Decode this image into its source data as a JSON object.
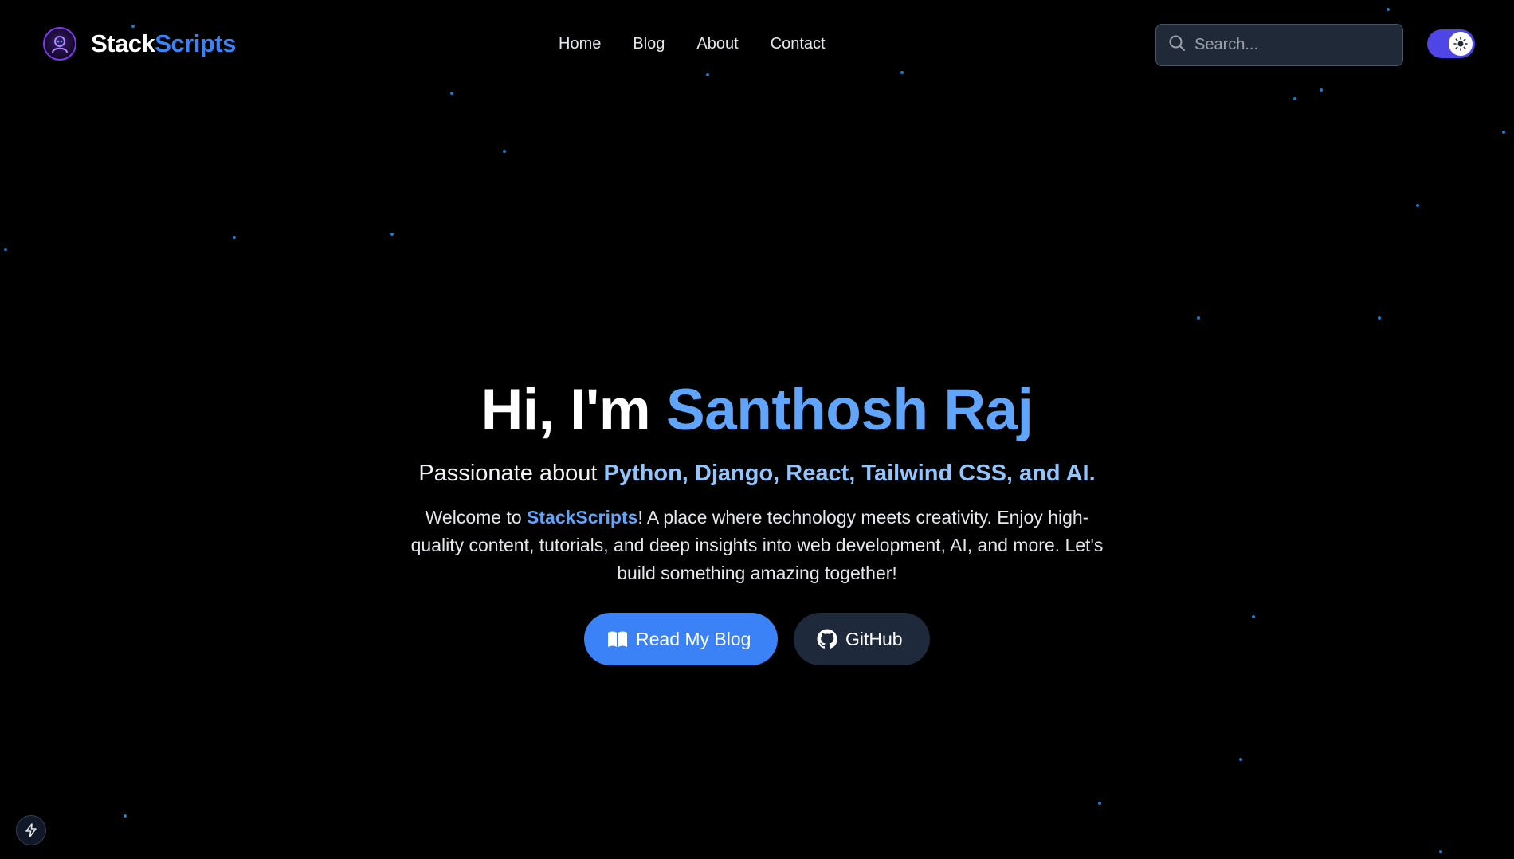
{
  "brand": {
    "name_part1": "Stack",
    "name_part2": "Scripts",
    "accent_color": "#3b82f6"
  },
  "nav": {
    "items": [
      {
        "label": "Home"
      },
      {
        "label": "Blog"
      },
      {
        "label": "About"
      },
      {
        "label": "Contact"
      }
    ]
  },
  "search": {
    "placeholder": "Search...",
    "icon": "search-icon"
  },
  "theme_toggle": {
    "icon": "sun-icon",
    "state": "on",
    "color": "#4f46e5"
  },
  "hero": {
    "greeting": "Hi, I'm ",
    "name": "Santhosh Raj",
    "subtitle_prefix": "Passionate about ",
    "subtitle_tech": "Python, Django, React, Tailwind CSS, and AI.",
    "desc_prefix": "Welcome to ",
    "desc_brand": "StackScripts",
    "desc_suffix": "! A place where technology meets creativity. Enjoy high-quality content, tutorials, and deep insights into web development, AI, and more. Let's build something amazing together!",
    "primary_button": {
      "label": "Read My Blog",
      "icon": "book-icon",
      "color": "#3b82f6"
    },
    "secondary_button": {
      "label": "GitHub",
      "icon": "github-icon",
      "color": "#1e293b"
    }
  },
  "floating_button": {
    "icon": "lightning-icon"
  }
}
